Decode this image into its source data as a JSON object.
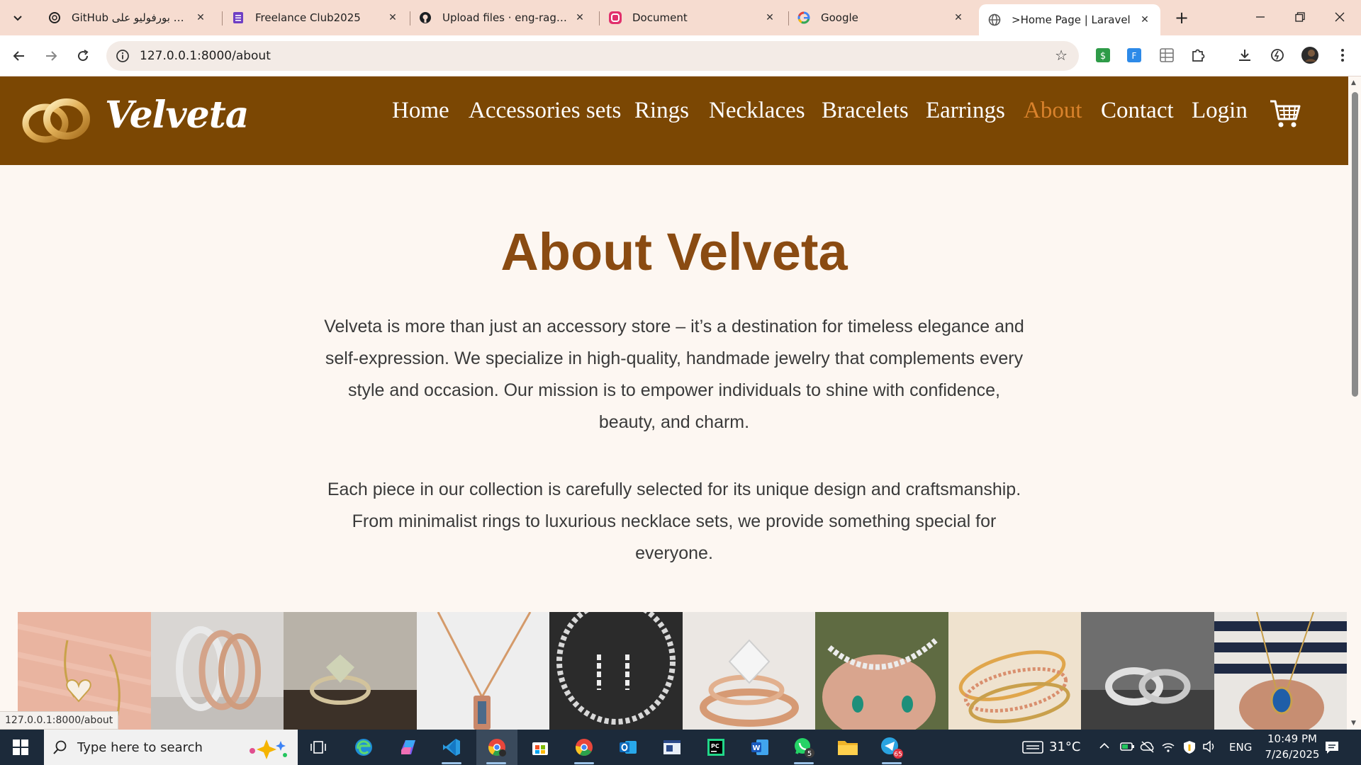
{
  "browser": {
    "tabs": [
      {
        "title": "GitHub عمل بورفوليو على",
        "favicon": "chatgpt-icon"
      },
      {
        "title": "Freelance Club2025",
        "favicon": "forms-icon"
      },
      {
        "title": "Upload files · eng-raghadsaleh",
        "favicon": "github-icon"
      },
      {
        "title": "Document",
        "favicon": "app-icon"
      },
      {
        "title": "Google",
        "favicon": "google-icon"
      },
      {
        "title": ">Home Page | Laravel",
        "favicon": "globe-icon",
        "active": true
      }
    ],
    "url": "127.0.0.1:8000/about",
    "status_url": "127.0.0.1:8000/about"
  },
  "site": {
    "brand": "Velveta",
    "nav": [
      "Home",
      "Accessories sets",
      "Rings",
      "Necklaces",
      "Bracelets",
      "Earrings",
      "About",
      "Contact",
      "Login"
    ],
    "active_nav": "About",
    "colors": {
      "header": "#7b4703",
      "accent": "#d9822b",
      "title": "#8a4b12",
      "background": "#fdf7f2"
    }
  },
  "about": {
    "title": "About Velveta",
    "paragraph1": "Velveta is more than just an accessory store – it’s a destination for timeless elegance and self-expression. We specialize in high-quality, handmade jewelry that complements every style and occasion. Our mission is to empower individuals to shine with confidence, beauty, and charm.",
    "paragraph2": "Each piece in our collection is carefully selected for its unique design and craftsmanship. From minimalist rings to luxurious necklace sets, we provide something special for everyone."
  },
  "gallery": [
    "heart-earrings-photo",
    "bangles-photo",
    "diamond-ring-photo",
    "pendant-necklace-photo",
    "necklace-set-photo",
    "engagement-rings-photo",
    "emerald-jewelry-photo",
    "beaded-bracelets-photo",
    "wedding-bands-photo",
    "sapphire-pendant-photo"
  ],
  "taskbar": {
    "search_placeholder": "Type here to search",
    "temperature": "31°C",
    "language": "ENG",
    "time": "10:49 PM",
    "date": "7/26/2025",
    "whatsapp_badge": "5",
    "telegram_badge": "65"
  }
}
